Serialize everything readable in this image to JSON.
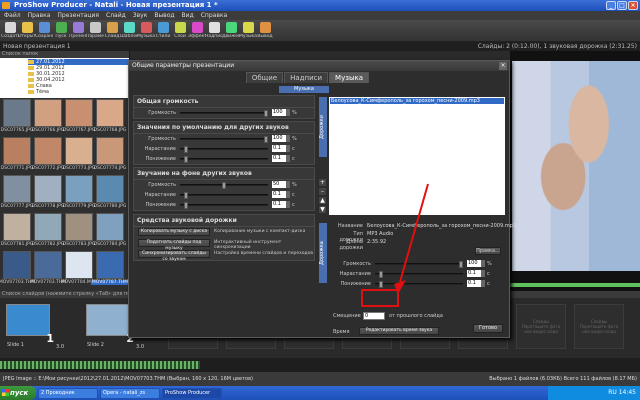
{
  "window": {
    "title": "ProShow Producer - Natali - Новая презентация 1 *"
  },
  "menu": [
    "Файл",
    "Правка",
    "Презентация",
    "Слайд",
    "Звук",
    "Вывод",
    "Вид",
    "Справка"
  ],
  "toolbar": [
    {
      "label": "Создать",
      "color": "#d9d9d9"
    },
    {
      "label": "Открыть",
      "color": "#e8c04a"
    },
    {
      "label": "Сохранить",
      "color": "#5a8fd8"
    },
    {
      "label": "Пуск",
      "color": "#4caf50"
    },
    {
      "label": "Презентация",
      "color": "#9a7ad8"
    },
    {
      "label": "Параметры",
      "color": "#c8c8c8"
    },
    {
      "label": "Слайд",
      "color": "#d8a04a"
    },
    {
      "label": "Шаблон",
      "color": "#5ad8c8"
    },
    {
      "label": "Музыка",
      "color": "#d85a5a"
    },
    {
      "label": "Стили",
      "color": "#4a9ad8"
    },
    {
      "label": "Слои",
      "color": "#c8d84a"
    },
    {
      "label": "Эффекты",
      "color": "#d84ac8"
    },
    {
      "label": "Надписи",
      "color": "#e0e0e0"
    },
    {
      "label": "Движения",
      "color": "#4ad87a"
    },
    {
      "label": "Музыка",
      "color": "#d8d84a"
    },
    {
      "label": "Вывод",
      "color": "#e09040"
    }
  ],
  "project": {
    "name": "Новая презентация 1",
    "stats": "Слайды: 2 (0:12.00), 1 звуковая дорожка (2:31.25)"
  },
  "folders": {
    "header": "Список папок",
    "items": [
      {
        "name": "27.01.2012",
        "selected": true
      },
      {
        "name": "29.01.2012",
        "selected": false
      },
      {
        "name": "30.01.2012",
        "selected": false
      },
      {
        "name": "30.04.2012",
        "selected": false
      },
      {
        "name": "Слава",
        "selected": false
      },
      {
        "name": "Тёма",
        "selected": false
      }
    ]
  },
  "thumbs": [
    {
      "name": "DSC07765.JPG",
      "color": "#6a7a8a",
      "selected": false
    },
    {
      "name": "DSC07766.JPG",
      "color": "#d0a080",
      "selected": false
    },
    {
      "name": "DSC07767.JPG",
      "color": "#c89070",
      "selected": false
    },
    {
      "name": "DSC07768.JPG",
      "color": "#d8a888",
      "selected": false
    },
    {
      "name": "DSC07771.JPG",
      "color": "#b88060",
      "selected": false
    },
    {
      "name": "DSC07772.JPG",
      "color": "#c08868",
      "selected": false
    },
    {
      "name": "DSC07773.JPG",
      "color": "#d8b090",
      "selected": false
    },
    {
      "name": "DSC07774.JPG",
      "color": "#c89878",
      "selected": false
    },
    {
      "name": "DSC07777.JPG",
      "color": "#8090a0",
      "selected": false
    },
    {
      "name": "DSC07778.JPG",
      "color": "#a0b0c0",
      "selected": false
    },
    {
      "name": "DSC07779.JPG",
      "color": "#7aa0c0",
      "selected": false
    },
    {
      "name": "DSC07780.JPG",
      "color": "#5a8ab0",
      "selected": false
    },
    {
      "name": "DSC07781.JPG",
      "color": "#c0b0a0",
      "selected": false
    },
    {
      "name": "DSC07782.JPG",
      "color": "#90a8b8",
      "selected": false
    },
    {
      "name": "DSC07783.JPG",
      "color": "#a09080",
      "selected": false
    },
    {
      "name": "DSC07784.JPG",
      "color": "#80a0c0",
      "selected": false
    },
    {
      "name": "MOV07703.THM",
      "color": "#3a5a8a",
      "selected": false
    },
    {
      "name": "MOV07703.THM",
      "color": "#4a6a9a",
      "selected": false
    },
    {
      "name": "MOV07704.MOV",
      "color": "#dde6f0",
      "selected": false
    },
    {
      "name": "MOV07787.THM",
      "color": "#3a6ab0",
      "selected": true
    }
  ],
  "slidelist": {
    "header": "Список слайдов (нажмите стрелку «Таб» для переключения в рамку)",
    "slides": [
      {
        "name": "Slide 1",
        "num": "1",
        "dur": "3.0",
        "color": "#3a8ad0"
      },
      {
        "name": "Slide 2",
        "num": "2",
        "dur": "3.0",
        "color": "#90b0d0"
      }
    ],
    "empty_slot": "Слайды\nПеретащите фото\nили видео сюда"
  },
  "status": {
    "left": "JPEG Image :: E:\\Мои рисунки\\2012\\27.01.2012\\MOV07703.THM (Выбран, 160 x 120, 16M цветов)",
    "right": "Выбрано 1 файлов (6.03КБ)  Всего 111 файлов (8.17 МБ)"
  },
  "taskbar": {
    "start": "пуск",
    "tasks": [
      {
        "label": "2 Проводник",
        "active": false
      },
      {
        "label": "Opera - natali_zs",
        "active": false
      },
      {
        "label": "ProShow Producer",
        "active": true
      }
    ],
    "clock": "RU  14:45"
  },
  "dialog": {
    "title": "Общие параметры презентации",
    "tabs": [
      {
        "label": "Общие",
        "active": false
      },
      {
        "label": "Надписи",
        "active": false
      },
      {
        "label": "Музыка",
        "active": true
      }
    ],
    "subtab": "Музыка",
    "sections": {
      "volume": {
        "header": "Общая громкость",
        "rows": [
          {
            "label": "Громкость",
            "value": "100",
            "unit": "%",
            "knob_pct": 1.0
          }
        ]
      },
      "defaults": {
        "header": "Значения по умолчанию для других звуков",
        "rows": [
          {
            "label": "Громкость",
            "value": "100",
            "unit": "%",
            "knob_pct": 1.0
          },
          {
            "label": "Нарастание",
            "value": "0.1",
            "unit": "с",
            "knob_pct": 0.05
          },
          {
            "label": "Понижение",
            "value": "0.1",
            "unit": "с",
            "knob_pct": 0.05
          }
        ]
      },
      "background": {
        "header": "Звучание на фоне других звуков",
        "rows": [
          {
            "label": "Громкость",
            "value": "50",
            "unit": "%",
            "knob_pct": 0.5
          },
          {
            "label": "Нарастание",
            "value": "0.1",
            "unit": "с",
            "knob_pct": 0.05
          },
          {
            "label": "Понижение",
            "value": "0.1",
            "unit": "с",
            "knob_pct": 0.05
          }
        ]
      },
      "tools": {
        "header": "Средства звуковой дорожки",
        "buttons": [
          {
            "label": "Копировать музыку с диска",
            "desc": "Копирование музыки с компакт-диска"
          },
          {
            "label": "Подогнать слайды под музыку",
            "desc": "Интерактивный инструмент синхронизации"
          },
          {
            "label": "Синхронизировать слайды со звуком",
            "desc": "Настройка времени слайдов и переходов"
          }
        ]
      }
    },
    "music": {
      "label_top": "Дорожки",
      "label_bottom": "Дорожка",
      "tracks": [
        "Белоусова_К-Симферополь_за горохом_песни-2009.mp3"
      ],
      "side_buttons": [
        "+",
        "–",
        "▲",
        "▼"
      ],
      "info": [
        {
          "key": "Название",
          "value": "Белоусова_К-Симферополь_за горохом_песни-2009.mp3"
        },
        {
          "key": "Тип дорожки",
          "value": "MP3 Audio"
        },
        {
          "key": "Длина дорожки",
          "value": "2:35.92"
        }
      ],
      "edit_button": "Правка...",
      "controls": [
        {
          "label": "Громкость",
          "value": "100",
          "unit": "%",
          "knob_pct": 1.0
        },
        {
          "label": "Нарастание",
          "value": "0.1",
          "unit": "с",
          "knob_pct": 0.05
        },
        {
          "label": "Понижение",
          "value": "0.1",
          "unit": "с",
          "knob_pct": 0.05
        }
      ],
      "offset": {
        "label": "Смещение",
        "value": "0",
        "suffix": "от прошлого слайда"
      },
      "timing_label": "Время",
      "timing_button": "Редактировать время звука"
    },
    "ok_button": "Готово"
  },
  "colors": {
    "accent_blue": "#4a6fb0",
    "selection": "#316ac5",
    "highlight_red": "#e01010"
  }
}
